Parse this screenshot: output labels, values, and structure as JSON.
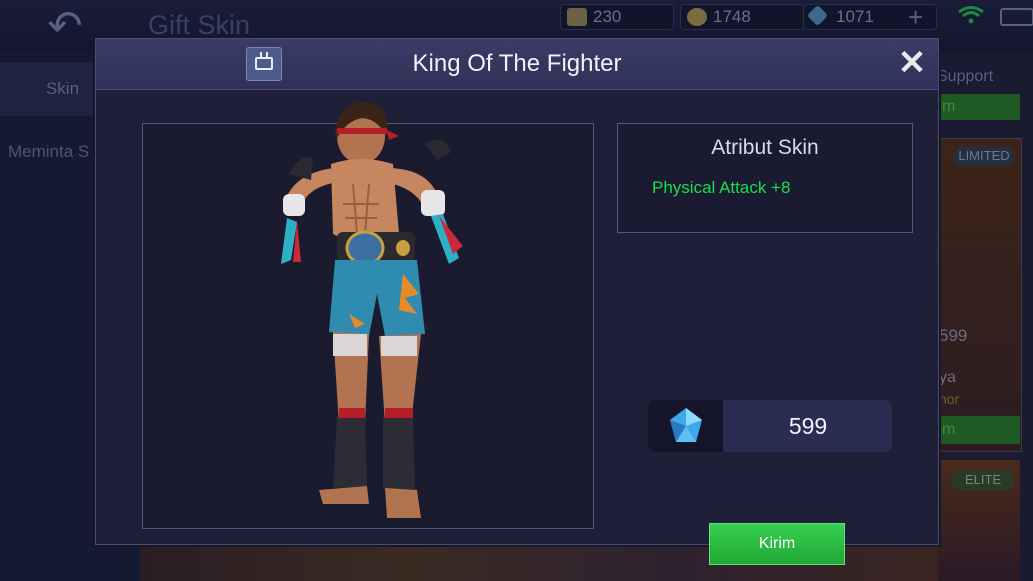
{
  "background": {
    "title": "Gift Skin",
    "resources": [
      {
        "icon": "scroll-icon",
        "value": "230"
      },
      {
        "icon": "coin-icon",
        "value": "1748"
      },
      {
        "icon": "diamond-icon",
        "value": "1071"
      }
    ],
    "left_tabs": {
      "skin": "Skin",
      "request": "Meminta S"
    },
    "right_panel": {
      "category": "Support",
      "card1_badge": "LIMITED",
      "card1_price": "599",
      "card1_name": "ya",
      "card1_type": "hor",
      "card2_badge": "ELITE",
      "button_partial_1": "m",
      "button_partial_2": "m"
    }
  },
  "dialog": {
    "title": "King Of The Fighter",
    "close_label": "✕",
    "attributes": {
      "heading": "Atribut Skin",
      "lines": [
        "Physical Attack +8"
      ]
    },
    "price": {
      "currency_icon": "diamond-icon",
      "value": "599"
    },
    "send_button": "Kirim"
  },
  "colors": {
    "attribute_text": "#17e04a",
    "send_button": "#2bbf45",
    "dialog_header": "#353761"
  }
}
